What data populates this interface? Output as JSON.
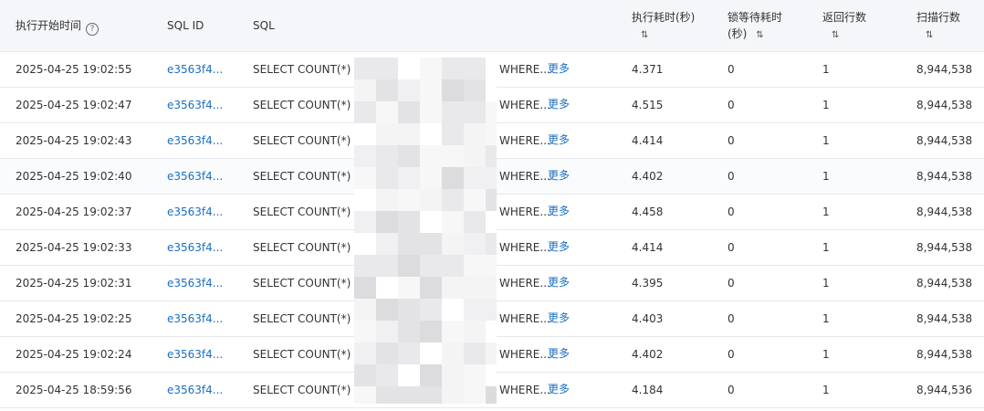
{
  "header": {
    "start_time": "执行开始时间",
    "help_icon": "?",
    "sql_id": "SQL ID",
    "sql": "SQL",
    "exec_time_line1": "执行耗时(秒)",
    "lock_time_line1": "锁等待耗时",
    "lock_time_line2": "(秒)",
    "rows_returned": "返回行数",
    "rows_scanned": "扫描行数",
    "sort_icon": "⇅"
  },
  "rows": [
    {
      "time": "2025-04-25 19:02:55",
      "sql_id": "e3563f4...",
      "sql_prefix": "SELECT COUNT(*) AS",
      "sql_suffix": "WHERE...",
      "more": "更多",
      "exec": "4.371",
      "lock": "0",
      "returned": "1",
      "scanned": "8,944,538"
    },
    {
      "time": "2025-04-25 19:02:47",
      "sql_id": "e3563f4...",
      "sql_prefix": "SELECT COUNT(*) AS",
      "sql_suffix": "WHERE...",
      "more": "更多",
      "exec": "4.515",
      "lock": "0",
      "returned": "1",
      "scanned": "8,944,538"
    },
    {
      "time": "2025-04-25 19:02:43",
      "sql_id": "e3563f4...",
      "sql_prefix": "SELECT COUNT(*) AS",
      "sql_suffix": "WHERE...",
      "more": "更多",
      "exec": "4.414",
      "lock": "0",
      "returned": "1",
      "scanned": "8,944,538"
    },
    {
      "time": "2025-04-25 19:02:40",
      "sql_id": "e3563f4...",
      "sql_prefix": "SELECT COUNT(*) AS",
      "sql_suffix": "WHERE...",
      "more": "更多",
      "exec": "4.402",
      "lock": "0",
      "returned": "1",
      "scanned": "8,944,538"
    },
    {
      "time": "2025-04-25 19:02:37",
      "sql_id": "e3563f4...",
      "sql_prefix": "SELECT COUNT(*) AS",
      "sql_suffix": "WHERE...",
      "more": "更多",
      "exec": "4.458",
      "lock": "0",
      "returned": "1",
      "scanned": "8,944,538"
    },
    {
      "time": "2025-04-25 19:02:33",
      "sql_id": "e3563f4...",
      "sql_prefix": "SELECT COUNT(*) AS",
      "sql_suffix": "WHERE...",
      "more": "更多",
      "exec": "4.414",
      "lock": "0",
      "returned": "1",
      "scanned": "8,944,538"
    },
    {
      "time": "2025-04-25 19:02:31",
      "sql_id": "e3563f4...",
      "sql_prefix": "SELECT COUNT(*) AS",
      "sql_suffix": "WHERE...",
      "more": "更多",
      "exec": "4.395",
      "lock": "0",
      "returned": "1",
      "scanned": "8,944,538"
    },
    {
      "time": "2025-04-25 19:02:25",
      "sql_id": "e3563f4...",
      "sql_prefix": "SELECT COUNT(*) AS",
      "sql_suffix": "WHERE...",
      "more": "更多",
      "exec": "4.403",
      "lock": "0",
      "returned": "1",
      "scanned": "8,944,538"
    },
    {
      "time": "2025-04-25 19:02:24",
      "sql_id": "e3563f4...",
      "sql_prefix": "SELECT COUNT(*) AS",
      "sql_suffix": "WHERE...",
      "more": "更多",
      "exec": "4.402",
      "lock": "0",
      "returned": "1",
      "scanned": "8,944,538"
    },
    {
      "time": "2025-04-25 18:59:56",
      "sql_id": "e3563f4...",
      "sql_prefix": "SELECT COUNT(*) AS",
      "sql_suffix": "WHERE...",
      "more": "更多",
      "exec": "4.184",
      "lock": "0",
      "returned": "1",
      "scanned": "8,944,536"
    }
  ],
  "colors": {
    "link": "#1a6fc4",
    "header_bg": "#f5f6f9",
    "border": "#e6e8ec",
    "text": "#333333"
  }
}
